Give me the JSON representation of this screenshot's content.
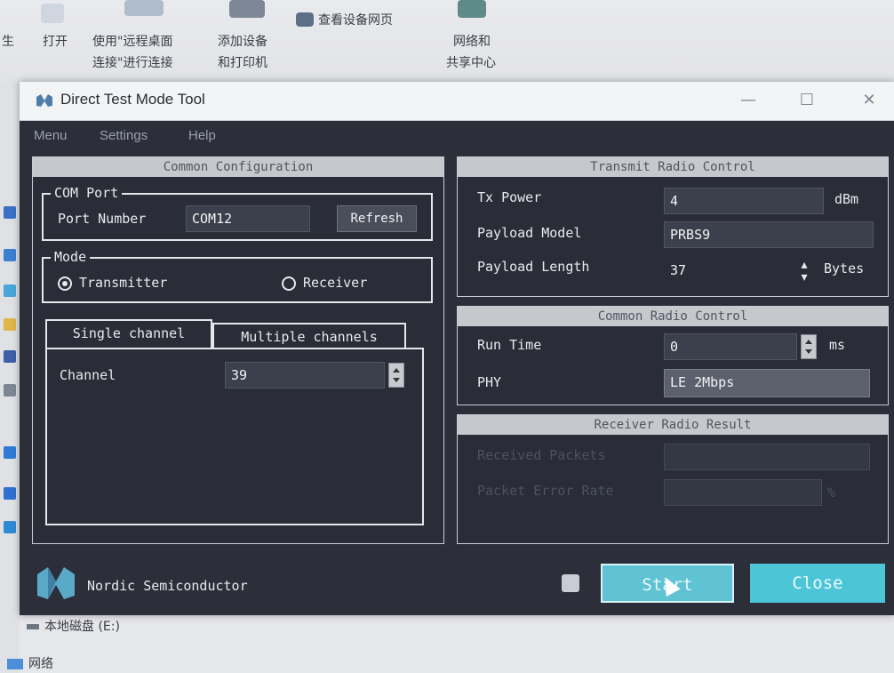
{
  "explorer": {
    "items": [
      {
        "label": "打开"
      },
      {
        "label_line1": "使用\"远程桌面",
        "label_line2": "连接\"进行连接"
      },
      {
        "label_line1": "添加设备",
        "label_line2": "和打印机"
      },
      {
        "label": "查看设备网页"
      },
      {
        "label_line1": "网络和",
        "label_line2": "共享中心"
      }
    ],
    "partial_left": "生",
    "drive_label": "本地磁盘 (E:)",
    "network_label": "网络"
  },
  "window": {
    "title": "Direct Test Mode Tool",
    "controls": {
      "minimize": "—",
      "maximize": "☐",
      "close": "✕"
    },
    "menu": [
      "Menu",
      "Settings",
      "Help"
    ]
  },
  "common_config": {
    "header": "Common Configuration",
    "com_port": {
      "group_title": "COM Port",
      "port_label": "Port Number",
      "port_value": "COM12",
      "refresh_label": "Refresh"
    },
    "mode": {
      "group_title": "Mode",
      "options": [
        "Transmitter",
        "Receiver"
      ],
      "selected": "Transmitter"
    },
    "tabs": [
      "Single channel",
      "Multiple channels"
    ],
    "active_tab": "Single channel",
    "channel_label": "Channel",
    "channel_value": "39"
  },
  "transmit": {
    "header": "Transmit Radio Control",
    "tx_power_label": "Tx Power",
    "tx_power_value": "4",
    "tx_power_unit": "dBm",
    "payload_model_label": "Payload Model",
    "payload_model_value": "PRBS9",
    "payload_length_label": "Payload Length",
    "payload_length_value": "37",
    "payload_length_unit": "Bytes"
  },
  "common_radio": {
    "header": "Common Radio Control",
    "run_time_label": "Run Time",
    "run_time_value": "0",
    "run_time_unit": "ms",
    "phy_label": "PHY",
    "phy_value": "LE 2Mbps"
  },
  "receiver": {
    "header": "Receiver Radio Result",
    "received_packets_label": "Received Packets",
    "received_packets_value": "",
    "per_label": "Packet Error Rate",
    "per_value": "",
    "per_unit": "%"
  },
  "footer": {
    "brand": "Nordic Semiconductor",
    "start_label": "Start",
    "close_label": "Close"
  },
  "colors": {
    "window_bg": "#2c2f3a",
    "panel_header": "#c6c8ce",
    "start_button": "#5fc3d3",
    "close_button": "#4cc6d6",
    "nordic_logo": "#5aa9c8"
  }
}
